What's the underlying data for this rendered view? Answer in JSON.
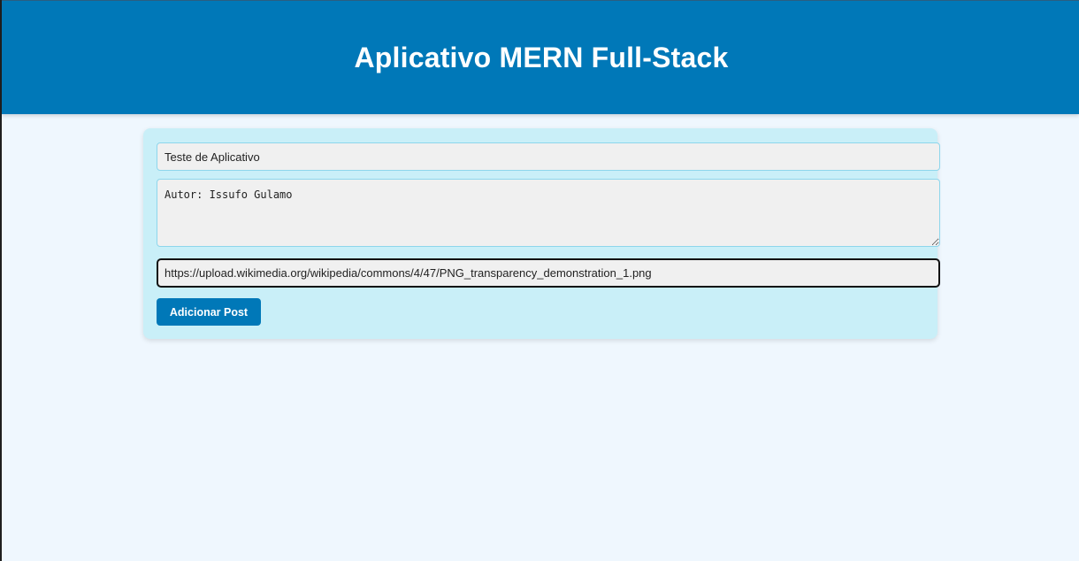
{
  "header": {
    "title": "Aplicativo MERN Full-Stack"
  },
  "form": {
    "title_field": {
      "value": "Teste de Aplicativo"
    },
    "content_field": {
      "value": "Autor: Issufo Gulamo"
    },
    "image_url_field": {
      "value": "https://upload.wikimedia.org/wikipedia/commons/4/47/PNG_transparency_demonstration_1.png"
    },
    "submit_label": "Adicionar Post"
  },
  "colors": {
    "header_bg": "#0078b8",
    "page_bg": "#eff7fe",
    "card_bg": "#c9eff8",
    "input_border": "#8dd6ec",
    "button_bg": "#0078b8"
  }
}
